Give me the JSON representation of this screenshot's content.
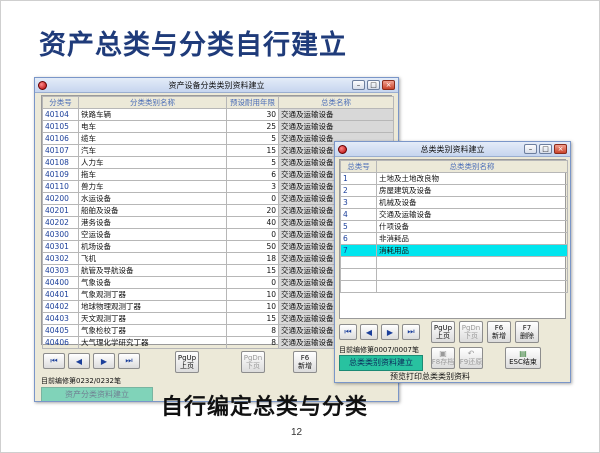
{
  "slide": {
    "title": "资产总类与分类自行建立",
    "subtitle": "自行编定总类与分类",
    "page_number": "12"
  },
  "win1": {
    "title": "资产设备分类类别资料建立",
    "headers": [
      "分类号",
      "分类类别名称",
      "预设耐用年限",
      "总类名称"
    ],
    "rows": [
      [
        "40104",
        "铁路车辆",
        "30",
        "交通及运输设备"
      ],
      [
        "40105",
        "电车",
        "25",
        "交通及运输设备"
      ],
      [
        "40106",
        "缆车",
        "5",
        "交通及运输设备"
      ],
      [
        "40107",
        "汽车",
        "15",
        "交通及运输设备"
      ],
      [
        "40108",
        "人力车",
        "5",
        "交通及运输设备"
      ],
      [
        "40109",
        "拖车",
        "6",
        "交通及运输设备"
      ],
      [
        "40110",
        "兽力车",
        "3",
        "交通及运输设备"
      ],
      [
        "40200",
        "水运设备",
        "0",
        "交通及运输设备"
      ],
      [
        "40201",
        "船舶及设备",
        "20",
        "交通及运输设备"
      ],
      [
        "40202",
        "港务设备",
        "40",
        "交通及运输设备"
      ],
      [
        "40300",
        "空运设备",
        "0",
        "交通及运输设备"
      ],
      [
        "40301",
        "机场设备",
        "50",
        "交通及运输设备"
      ],
      [
        "40302",
        "飞机",
        "18",
        "交通及运输设备"
      ],
      [
        "40303",
        "航管及导航设备",
        "15",
        "交通及运输设备"
      ],
      [
        "40400",
        "气象设备",
        "0",
        "交通及运输设备"
      ],
      [
        "40401",
        "气象观测丁器",
        "10",
        "交通及运输设备"
      ],
      [
        "40402",
        "地球物理观测丁器",
        "10",
        "交通及运输设备"
      ],
      [
        "40403",
        "天文观测丁器",
        "15",
        "交通及运输设备"
      ],
      [
        "40405",
        "气象检校丁器",
        "8",
        "交通及运输设备"
      ],
      [
        "40406",
        "大气理化学研究丁器",
        "8",
        "交通及运输设备"
      ]
    ],
    "nav": {
      "first": "⏮",
      "prev": "◀",
      "next": "▶",
      "last": "⏭"
    },
    "btn_pgup": [
      "PgUp",
      "上页"
    ],
    "btn_pgdn": [
      "PgDn",
      "下页"
    ],
    "btn_f6": [
      "F6",
      "新增"
    ],
    "record_status": "目前编修第0232/0232笔",
    "green_label": "资产分类资料建立"
  },
  "win2": {
    "title": "总类类别资料建立",
    "headers": [
      "总类号",
      "总类类别名称"
    ],
    "rows": [
      [
        "1",
        "土地及土地改良物"
      ],
      [
        "2",
        "房屋建筑及设备"
      ],
      [
        "3",
        "机械及设备"
      ],
      [
        "4",
        "交通及运输设备"
      ],
      [
        "5",
        "什项设备"
      ],
      [
        "6",
        "非消耗品"
      ],
      [
        "7",
        "消耗用品"
      ]
    ],
    "nav": {
      "first": "⏮",
      "prev": "◀",
      "next": "▶",
      "last": "⏭"
    },
    "btn_pgup": [
      "PgUp",
      "上页"
    ],
    "btn_pgdn": [
      "PgDn",
      "下页"
    ],
    "btn_f6": [
      "F6",
      "新增"
    ],
    "btn_f7": [
      "F7",
      "删除"
    ],
    "btn_f8": "F8存档",
    "btn_f9": "F9还原",
    "btn_esc": "ESC结束",
    "record_status": "目前编修第0007/0007笔",
    "green_label": "总类类别资料建立",
    "footer_text": "预览打印总类类别资料"
  },
  "colors": {
    "title": "#1f3b7a",
    "header_text": "#4a6db8",
    "selected_row": "#00e5ee",
    "green_button": "#28c2a0"
  }
}
